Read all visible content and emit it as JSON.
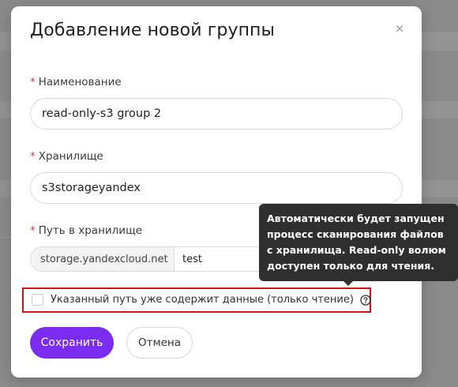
{
  "modal": {
    "title": "Добавление новой группы",
    "close_label": "×"
  },
  "fields": {
    "name": {
      "label": "Наименование",
      "value": "read-only-s3 group 2"
    },
    "storage": {
      "label": "Хранилище",
      "value": "s3storageyandex"
    },
    "path": {
      "label": "Путь в хранилище",
      "prefix": "storage.yandexcloud.net",
      "value": "test"
    }
  },
  "checkbox": {
    "label": "Указанный путь уже содержит данные (только чтение)",
    "checked": false
  },
  "tooltip": {
    "text": "Автоматически будет запущен процесс сканирования файлов с хранилища. Read-only волюм доступен только для чтения."
  },
  "buttons": {
    "save": "Сохранить",
    "cancel": "Отмена"
  },
  "colors": {
    "primary": "#7a2df0",
    "highlight": "#e01010",
    "required": "#e0362f",
    "tooltip_bg": "#2f2f2f"
  }
}
